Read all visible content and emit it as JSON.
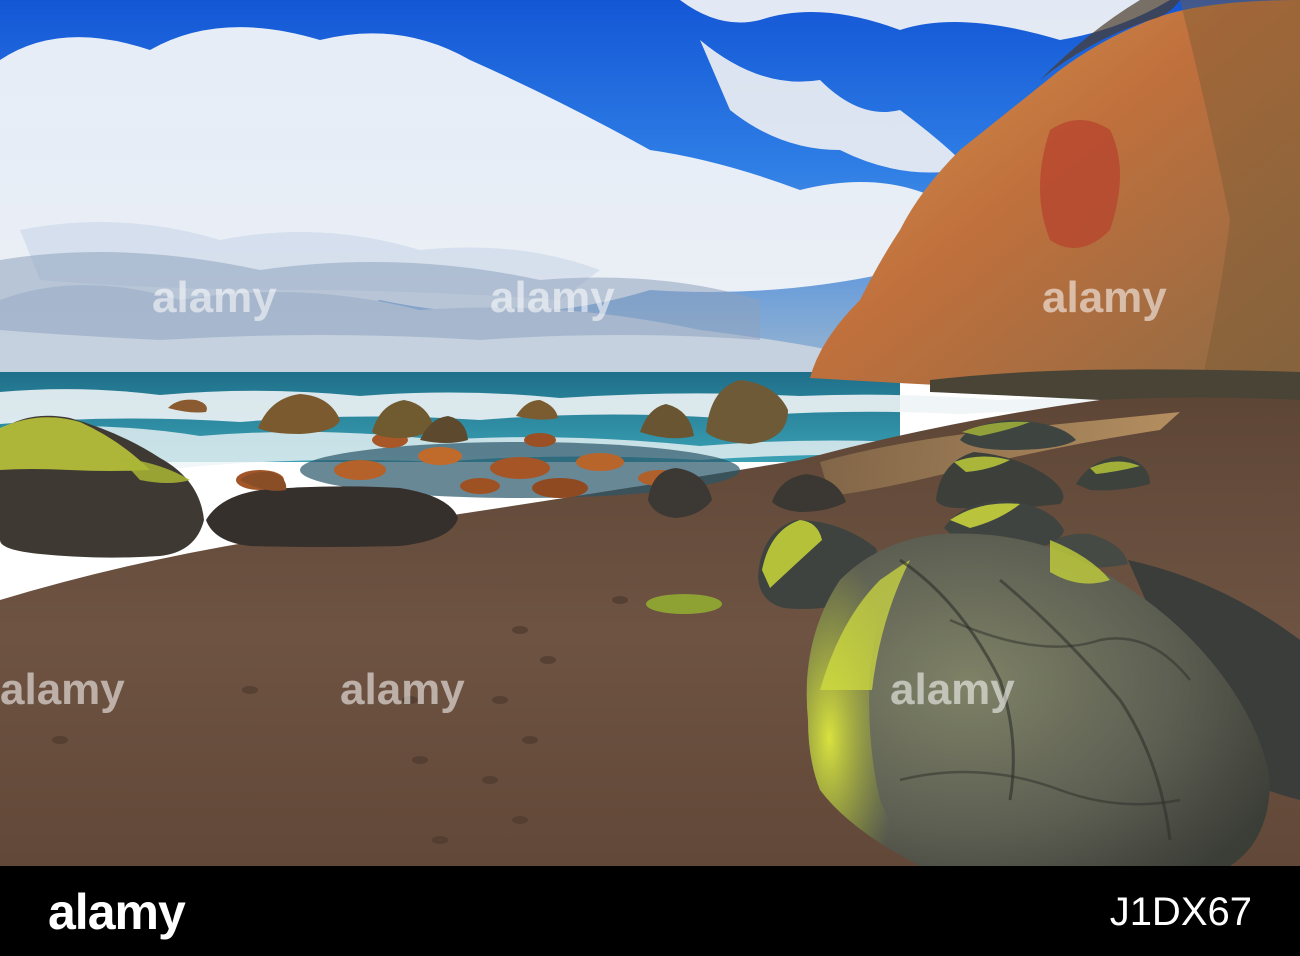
{
  "photo": {
    "watermark_text": "alamy"
  },
  "footer": {
    "logo_text": "alamy",
    "image_id": "J1DX67"
  },
  "colors": {
    "sky_blue": "#1e6fe0",
    "cloud_white": "#f4f6fa",
    "sea_teal": "#2f8ea6",
    "foam_white": "#eef4f6",
    "sand_brown": "#6b5140",
    "cliff_orange": "#c9823f",
    "moss_yellow": "#c7d43a",
    "footer_black": "#000000"
  }
}
